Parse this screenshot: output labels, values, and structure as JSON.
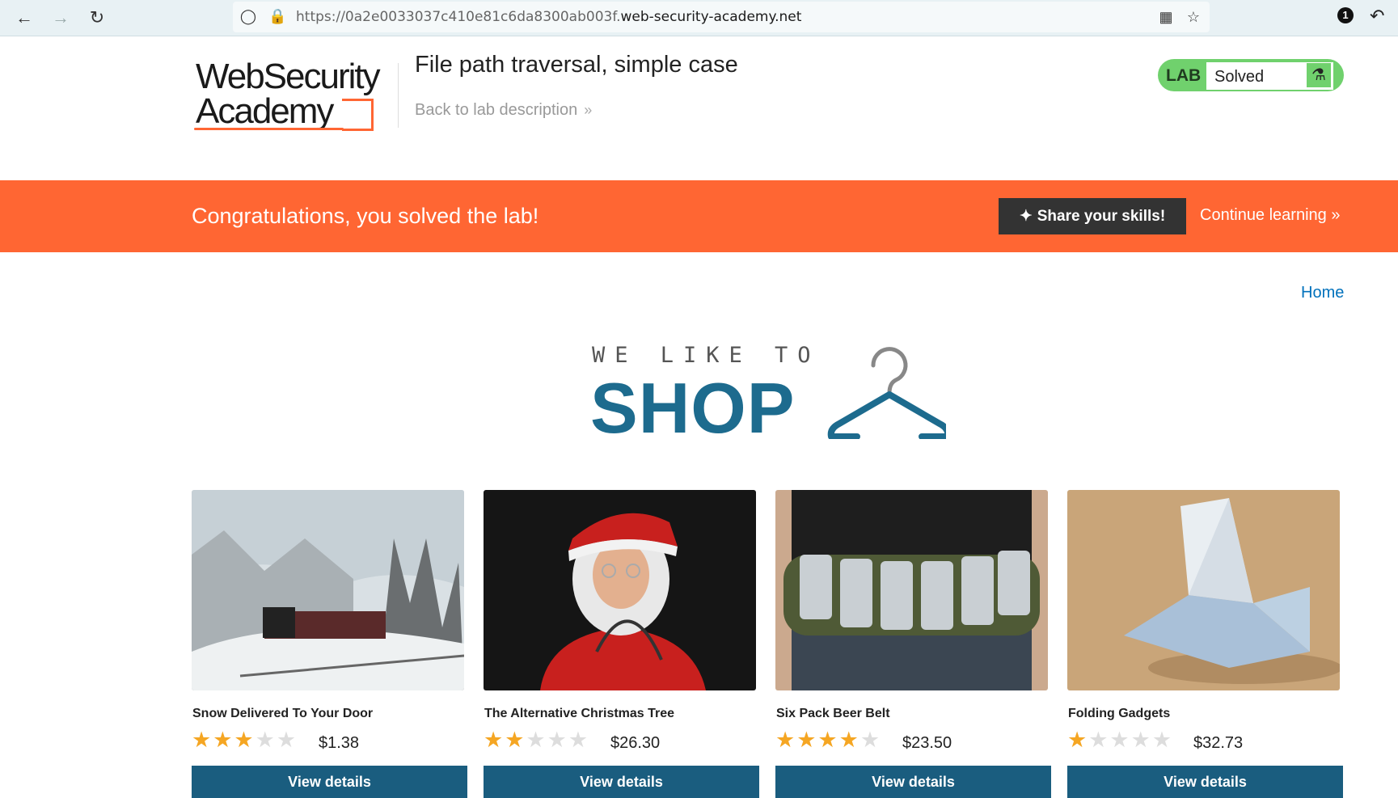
{
  "browser": {
    "url_prefix": "https://0a2e0033037c410e81c6da8300ab003f.",
    "url_host": "web-security-academy.net",
    "extension_badge": "1"
  },
  "header": {
    "logo_line1": "WebSecurity",
    "logo_line2": "Academy",
    "lab_title": "File path traversal, simple case",
    "back_link": "Back to lab description",
    "lab_badge": "LAB",
    "lab_status": "Solved"
  },
  "banner": {
    "message": "Congratulations, you solved the lab!",
    "share_label": "Share your skills!",
    "continue_label": "Continue learning"
  },
  "nav": {
    "home": "Home"
  },
  "shop": {
    "tagline": "WE LIKE TO",
    "word": "SHOP",
    "products": [
      {
        "name": "Snow Delivered To Your Door",
        "rating": 3,
        "price": "$1.38",
        "button": "View details"
      },
      {
        "name": "The Alternative Christmas Tree",
        "rating": 2,
        "price": "$26.30",
        "button": "View details"
      },
      {
        "name": "Six Pack Beer Belt",
        "rating": 4,
        "price": "$23.50",
        "button": "View details"
      },
      {
        "name": "Folding Gadgets",
        "rating": 1,
        "price": "$32.73",
        "button": "View details"
      }
    ]
  },
  "colors": {
    "accent_orange": "#ff6633",
    "lab_green": "#70d16d",
    "shop_blue": "#1d6b8e",
    "button_blue": "#1a5d7f",
    "star_gold": "#f5a623"
  }
}
